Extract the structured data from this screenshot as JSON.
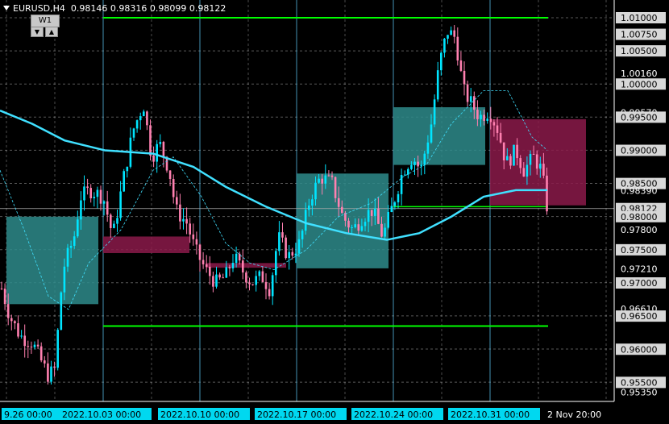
{
  "header": {
    "symbol": "EURUSD,H4",
    "open": "0.98146",
    "high": "0.98316",
    "low": "0.98099",
    "close": "0.98122"
  },
  "toolbar": {
    "timeframe_label": "W1",
    "down_arrow": "▼",
    "up_arrow": "▲"
  },
  "colors": {
    "background": "#000000",
    "bull": "#00e5ff",
    "bear": "#ff80b0",
    "ma": "#40e0ff",
    "ma_dashed": "#40e0ff",
    "green_lines": "#00ff00",
    "teal_box": "#2e8b8b",
    "pink_box": "#8b1a4a",
    "grid": "#ffffff",
    "vline": "#5fd0ff"
  },
  "chart_data": {
    "type": "candlestick",
    "symbol": "EURUSD",
    "timeframe": "H4",
    "ylim": [
      0.953,
      1.012
    ],
    "price_ticks": [
      "1.01000",
      "1.00750",
      "1.00500",
      "1.00160",
      "1.00000",
      "0.99570",
      "0.99500",
      "0.99000",
      "0.98500",
      "0.98390",
      "0.98122",
      "0.98000",
      "0.97800",
      "0.97500",
      "0.97210",
      "0.97000",
      "0.96610",
      "0.96500",
      "0.96000",
      "0.95500",
      "0.95350"
    ],
    "highlighted_ticks": [
      "1.01000",
      "1.00750",
      "1.00500",
      "1.00000",
      "0.99500",
      "0.99000",
      "0.98500",
      "0.98122",
      "0.98000",
      "0.97500",
      "0.97000",
      "0.96500",
      "0.96000",
      "0.95500"
    ],
    "time_labels": [
      "9.26 00:00",
      "2022.10.03 00:00",
      "2022.10.10 00:00",
      "2022.10.17 00:00",
      "2022.10.24 00:00",
      "2022.10.31 00:00",
      "2 Nov 20:00"
    ],
    "horizontal_levels": [
      1.01,
      0.9812,
      0.9635
    ],
    "current_price": 0.98122
  }
}
